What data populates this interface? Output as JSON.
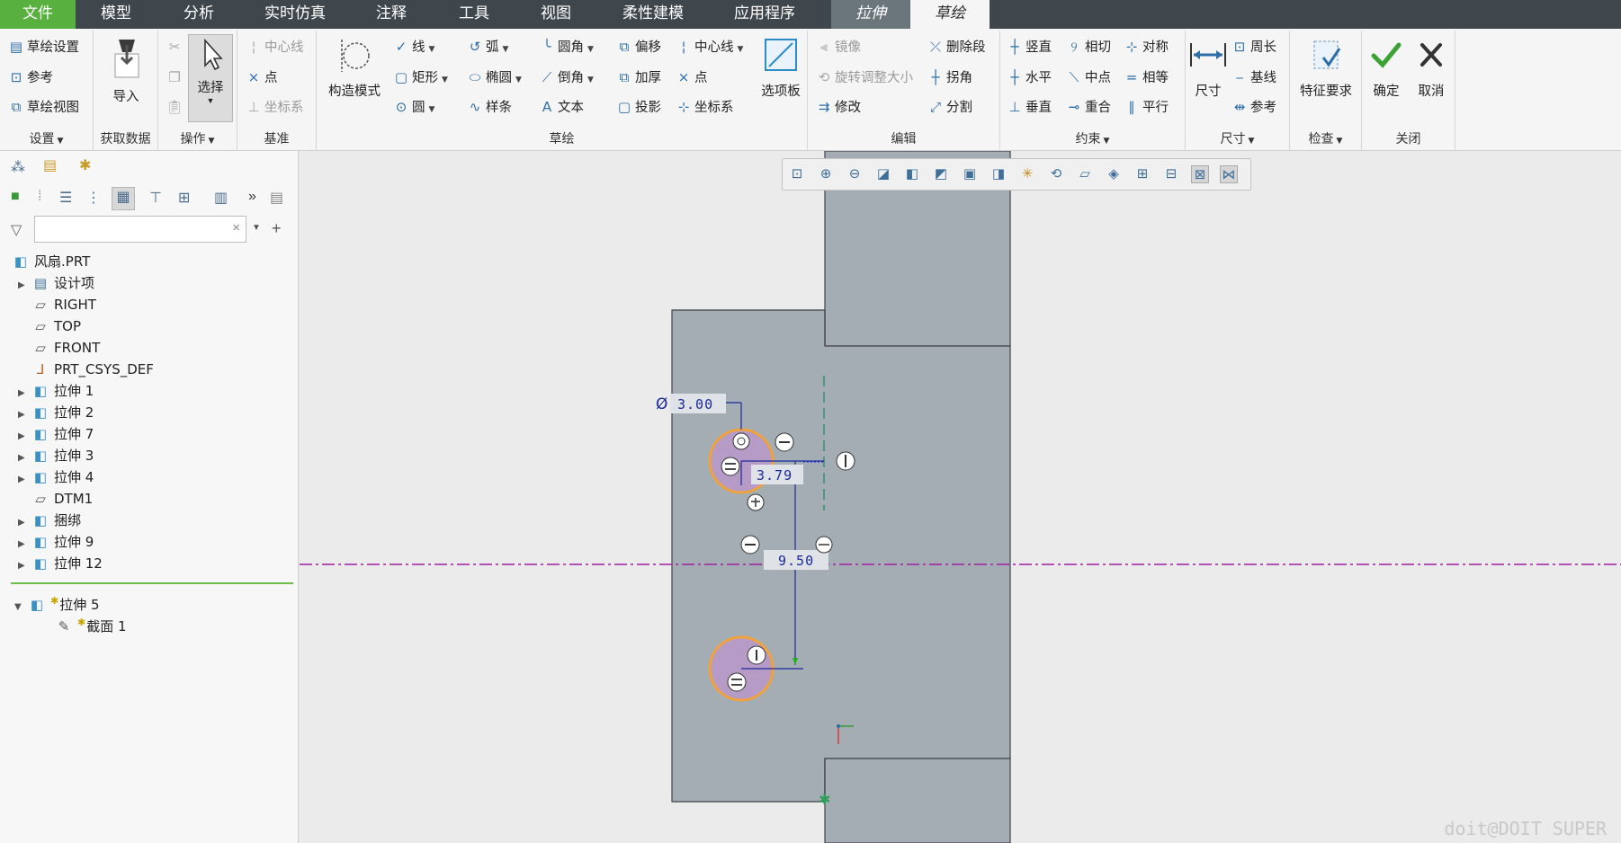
{
  "menu": {
    "tabs": [
      "文件",
      "模型",
      "分析",
      "实时仿真",
      "注释",
      "工具",
      "视图",
      "柔性建模",
      "应用程序",
      "拉伸",
      "草绘"
    ]
  },
  "ribbon": {
    "settings": {
      "items": [
        "草绘设置",
        "参考",
        "草绘视图"
      ],
      "label": "设置"
    },
    "getdata": {
      "import": "导入",
      "label": "获取数据"
    },
    "operations": {
      "select": "选择",
      "label": "操作"
    },
    "datum": {
      "items": [
        "中心线",
        "点",
        "坐标系"
      ],
      "label": "基准"
    },
    "sketch": {
      "construction": "构造模式",
      "col1": [
        "线",
        "矩形",
        "圆"
      ],
      "col2": [
        "弧",
        "椭圆",
        "样条"
      ],
      "col3": [
        "圆角",
        "倒角",
        "文本"
      ],
      "col4": [
        "偏移",
        "加厚",
        "投影"
      ],
      "col5": [
        "中心线",
        "点",
        "坐标系"
      ],
      "palette": "选项板",
      "label": "草绘"
    },
    "edit": {
      "col1": [
        "镜像",
        "旋转调整大小",
        "修改"
      ],
      "col2": [
        "删除段",
        "拐角",
        "分割"
      ],
      "label": "编辑"
    },
    "constrain": {
      "col1": [
        "竖直",
        "水平",
        "垂直"
      ],
      "col2": [
        "相切",
        "中点",
        "重合"
      ],
      "col3": [
        "对称",
        "相等",
        "平行"
      ],
      "label": "约束"
    },
    "dimension": {
      "dim": "尺寸",
      "items": [
        "周长",
        "基线",
        "参考"
      ],
      "label": "尺寸"
    },
    "inspect": {
      "feature_req": "特征要求",
      "label": "检查"
    },
    "close": {
      "ok": "确定",
      "cancel": "取消",
      "label": "关闭"
    }
  },
  "tree": {
    "root": "风扇.PRT",
    "items": [
      "设计项",
      "RIGHT",
      "TOP",
      "FRONT",
      "PRT_CSYS_DEF",
      "拉伸 1",
      "拉伸 2",
      "拉伸 7",
      "拉伸 3",
      "拉伸 4",
      "DTM1",
      "捆绑",
      "拉伸 9",
      "拉伸 12"
    ],
    "active_feature": "拉伸 5",
    "active_section": "截面 1"
  },
  "sketch": {
    "dim_diameter": "3.00",
    "dim_horizontal": "3.79",
    "dim_vertical": "9.50"
  },
  "colors": {
    "menubar": "#3f474d",
    "file_tab": "#58b13f",
    "part_fill": "#a5adb4",
    "circle_fill": "#b69bc6",
    "circle_stroke": "#f0a23c",
    "centerline": "#a020a0"
  },
  "watermark": "doit@DOIT SUPER"
}
